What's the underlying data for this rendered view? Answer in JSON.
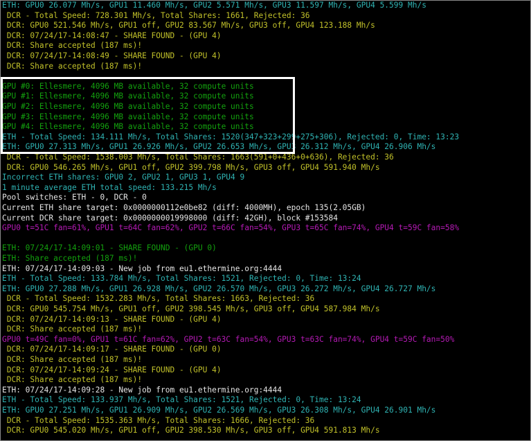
{
  "colors": {
    "teal": "#2fb3b3",
    "yellow": "#c1c12a",
    "green": "#13a10e",
    "white": "#e6e6e6",
    "magenta": "#b51ab5",
    "background": "#000000",
    "highlight_border": "#ffffff"
  },
  "console": {
    "lines": [
      {
        "color": "teal",
        "text": "ETH: GPU0 26.077 Mh/s, GPU1 11.460 Mh/s, GPU2 5.571 Mh/s, GPU3 11.597 Mh/s, GPU4 5.599 Mh/s"
      },
      {
        "color": "yellow",
        "text": " DCR - Total Speed: 728.301 Mh/s, Total Shares: 1661, Rejected: 36"
      },
      {
        "color": "yellow",
        "text": " DCR: GPU0 521.546 Mh/s, GPU1 off, GPU2 83.567 Mh/s, GPU3 off, GPU4 123.188 Mh/s"
      },
      {
        "color": "yellow",
        "text": " DCR: 07/24/17-14:08:47 - SHARE FOUND - (GPU 4)"
      },
      {
        "color": "yellow",
        "text": " DCR: Share accepted (187 ms)!"
      },
      {
        "color": "yellow",
        "text": " DCR: 07/24/17-14:08:49 - SHARE FOUND - (GPU 4)"
      },
      {
        "color": "yellow",
        "text": " DCR: Share accepted (187 ms)!"
      },
      {
        "color": "green",
        "text": ""
      },
      {
        "color": "green",
        "text": "GPU #0: Ellesmere, 4096 MB available, 32 compute units"
      },
      {
        "color": "green",
        "text": "GPU #1: Ellesmere, 4096 MB available, 32 compute units"
      },
      {
        "color": "green",
        "text": "GPU #2: Ellesmere, 4096 MB available, 32 compute units"
      },
      {
        "color": "green",
        "text": "GPU #3: Ellesmere, 4096 MB available, 32 compute units"
      },
      {
        "color": "green",
        "text": "GPU #4: Ellesmere, 4096 MB available, 32 compute units"
      },
      {
        "color": "teal",
        "text": "ETH - Total Speed: 134.111 Mh/s, Total Shares: 1520(347+323+299+275+306), Rejected: 0, Time: 13:23"
      },
      {
        "color": "teal",
        "text": "ETH: GPU0 27.313 Mh/s, GPU1 26.926 Mh/s, GPU2 26.653 Mh/s, GPU3 26.312 Mh/s, GPU4 26.906 Mh/s"
      },
      {
        "color": "yellow",
        "text": " DCR - Total Speed: 1538.003 Mh/s, Total Shares: 1663(591+0+436+0+636), Rejected: 36"
      },
      {
        "color": "yellow",
        "text": " DCR: GPU0 546.265 Mh/s, GPU1 off, GPU2 399.798 Mh/s, GPU3 off, GPU4 591.940 Mh/s"
      },
      {
        "color": "teal",
        "text": "Incorrect ETH shares: GPU0 2, GPU2 1, GPU3 1, GPU4 9"
      },
      {
        "color": "teal",
        "text": "1 minute average ETH total speed: 133.215 Mh/s"
      },
      {
        "color": "white",
        "text": "Pool switches: ETH - 0, DCR - 0"
      },
      {
        "color": "white",
        "text": "Current ETH share target: 0x0000000112e0be82 (diff: 4000MH), epoch 135(2.05GB)"
      },
      {
        "color": "white",
        "text": "Current DCR share target: 0x0000000019998000 (diff: 42GH), block #153584"
      },
      {
        "color": "magenta",
        "text": "GPU0 t=51C fan=61%, GPU1 t=64C fan=62%, GPU2 t=66C fan=54%, GPU3 t=65C fan=74%, GPU4 t=59C fan=58%"
      },
      {
        "color": "green",
        "text": ""
      },
      {
        "color": "green",
        "text": "ETH: 07/24/17-14:09:01 - SHARE FOUND - (GPU 0)"
      },
      {
        "color": "green",
        "text": "ETH: Share accepted (187 ms)!"
      },
      {
        "color": "white",
        "text": "ETH: 07/24/17-14:09:03 - New job from eu1.ethermine.org:4444"
      },
      {
        "color": "teal",
        "text": "ETH - Total Speed: 133.784 Mh/s, Total Shares: 1521, Rejected: 0, Time: 13:24"
      },
      {
        "color": "teal",
        "text": "ETH: GPU0 27.288 Mh/s, GPU1 26.928 Mh/s, GPU2 26.570 Mh/s, GPU3 26.272 Mh/s, GPU4 26.727 Mh/s"
      },
      {
        "color": "yellow",
        "text": " DCR - Total Speed: 1532.283 Mh/s, Total Shares: 1663, Rejected: 36"
      },
      {
        "color": "yellow",
        "text": " DCR: GPU0 545.754 Mh/s, GPU1 off, GPU2 398.545 Mh/s, GPU3 off, GPU4 587.984 Mh/s"
      },
      {
        "color": "yellow",
        "text": " DCR: 07/24/17-14:09:13 - SHARE FOUND - (GPU 4)"
      },
      {
        "color": "yellow",
        "text": " DCR: Share accepted (187 ms)!"
      },
      {
        "color": "magenta",
        "text": "GPU0 t=49C fan=0%, GPU1 t=61C fan=62%, GPU2 t=63C fan=54%, GPU3 t=63C fan=74%, GPU4 t=59C fan=50%"
      },
      {
        "color": "yellow",
        "text": " DCR: 07/24/17-14:09:17 - SHARE FOUND - (GPU 0)"
      },
      {
        "color": "yellow",
        "text": " DCR: Share accepted (187 ms)!"
      },
      {
        "color": "yellow",
        "text": " DCR: 07/24/17-14:09:24 - SHARE FOUND - (GPU 4)"
      },
      {
        "color": "yellow",
        "text": " DCR: Share accepted (187 ms)!"
      },
      {
        "color": "white",
        "text": "ETH: 07/24/17-14:09:28 - New job from eu1.ethermine.org:4444"
      },
      {
        "color": "teal",
        "text": "ETH - Total Speed: 133.937 Mh/s, Total Shares: 1521, Rejected: 0, Time: 13:24"
      },
      {
        "color": "teal",
        "text": "ETH: GPU0 27.251 Mh/s, GPU1 26.909 Mh/s, GPU2 26.569 Mh/s, GPU3 26.308 Mh/s, GPU4 26.901 Mh/s"
      },
      {
        "color": "yellow",
        "text": " DCR - Total Speed: 1535.363 Mh/s, Total Shares: 1666, Rejected: 36"
      },
      {
        "color": "yellow",
        "text": " DCR: GPU0 545.020 Mh/s, GPU1 off, GPU2 398.530 Mh/s, GPU3 off, GPU4 591.813 Mh/s"
      }
    ]
  }
}
